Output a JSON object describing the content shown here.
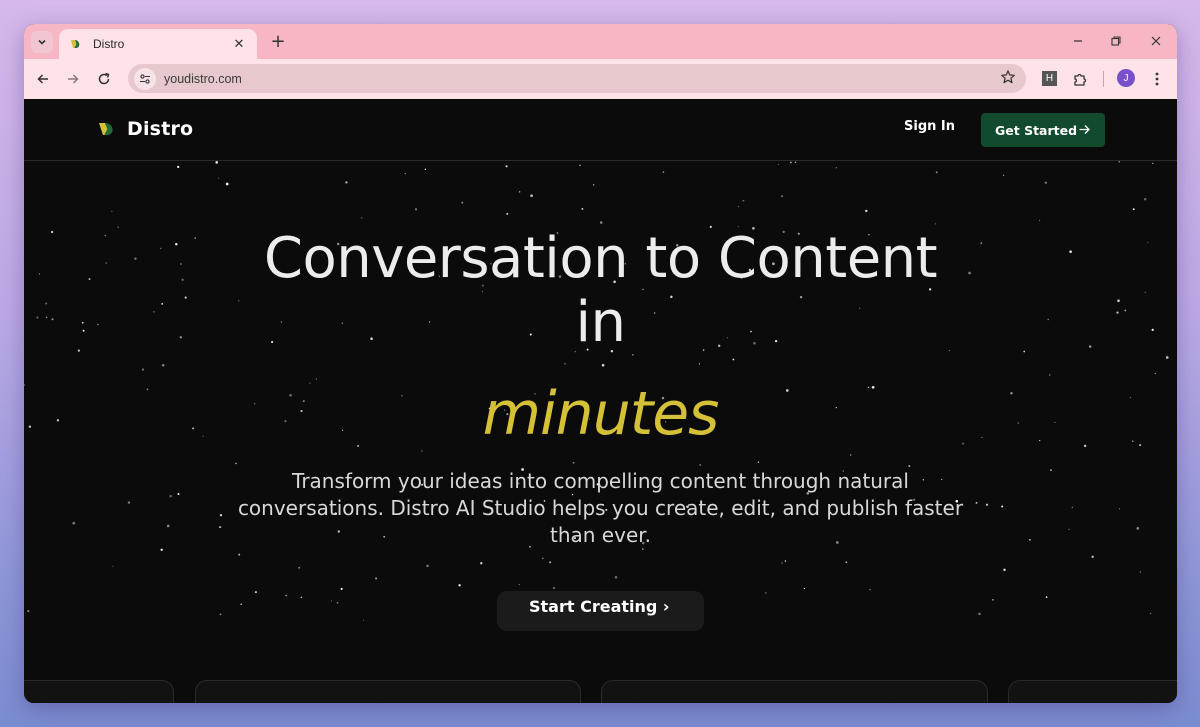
{
  "browser": {
    "tab_title": "Distro",
    "url": "youdistro.com",
    "extension_label": "H",
    "avatar_initial": "J"
  },
  "nav": {
    "brand": "Distro",
    "signin_label": "Sign In",
    "cta_label": "Get Started"
  },
  "hero": {
    "title_line1": "Conversation to Content",
    "title_line2": "in",
    "accent": "minutes",
    "subtitle": "Transform your ideas into compelling content through natural conversations. Distro AI Studio helps you create, edit, and publish faster than ever.",
    "cta_label": "Start Creating"
  },
  "colors": {
    "accent": "#d4c138",
    "cta_green": "#114a2c",
    "page_bg": "#0c0b0b",
    "tab_strip": "#f7b6c3"
  }
}
